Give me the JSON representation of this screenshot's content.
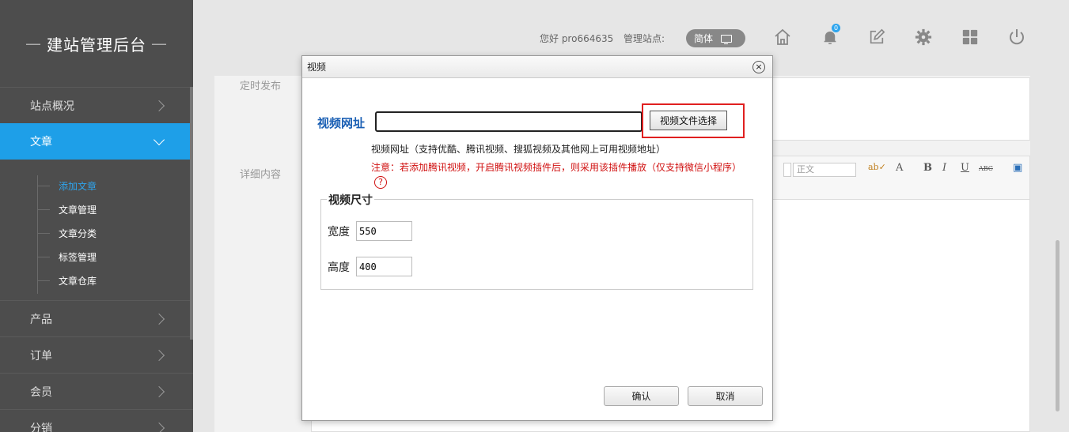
{
  "sidebar": {
    "brand": "建站管理后台",
    "brand_dash": "—",
    "items": [
      {
        "label": "站点概况"
      },
      {
        "label": "文章"
      },
      {
        "label": "产品"
      },
      {
        "label": "订单"
      },
      {
        "label": "会员"
      },
      {
        "label": "分销"
      }
    ],
    "subitems": [
      {
        "label": "添加文章"
      },
      {
        "label": "文章管理"
      },
      {
        "label": "文章分类"
      },
      {
        "label": "标签管理"
      },
      {
        "label": "文章仓库"
      }
    ]
  },
  "topbar": {
    "greeting": "您好 pro664635",
    "site_label": "管理站点:",
    "lang": "简体",
    "notification_count": "0",
    "icons": [
      "home-icon",
      "bell-icon",
      "edit-icon",
      "gear-icon",
      "grid-icon",
      "power-icon"
    ]
  },
  "main": {
    "schedule_label": "定时发布",
    "detail_label": "详细内容",
    "toolbar": {
      "paragraph": "正文",
      "font_a": "A",
      "bold": "B",
      "italic": "I",
      "underline": "U",
      "strike": "ABC"
    }
  },
  "dialog": {
    "title": "视频",
    "close": "×",
    "url_label": "视频网址",
    "url_value": "",
    "pick_button": "视频文件选择",
    "hint": "视频网址（支持优酷、腾讯视频、搜狐视频及其他网上可用视频地址）",
    "warning": "注意：若添加腾讯视频，开启腾讯视频插件后，则采用该插件播放（仅支持微信小程序）",
    "help": "?",
    "size_legend": "视频尺寸",
    "width_label": "宽度",
    "width_value": "550",
    "height_label": "高度",
    "height_value": "400",
    "confirm": "确认",
    "cancel": "取消"
  },
  "colors": {
    "accent": "#1e9fe8",
    "sidebar_bg": "#4d4d4d",
    "highlight": "#e02020",
    "warning": "#d01010"
  }
}
